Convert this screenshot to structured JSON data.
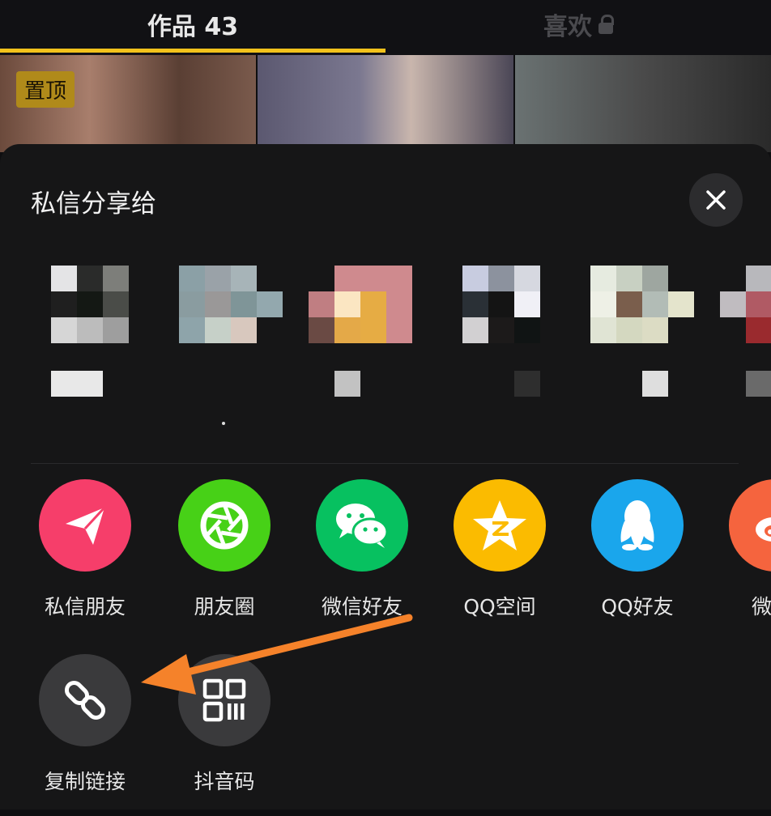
{
  "tabs": {
    "works": "作品 43",
    "likes": "喜欢"
  },
  "grid": {
    "pinned_badge": "置顶"
  },
  "share_sheet": {
    "title": "私信分享给",
    "apps": [
      {
        "label": "私信朋友",
        "icon": "paper-plane-icon",
        "color": "#f63e6a"
      },
      {
        "label": "朋友圈",
        "icon": "aperture-icon",
        "color": "#47d117"
      },
      {
        "label": "微信好友",
        "icon": "wechat-icon",
        "color": "#07c160"
      },
      {
        "label": "QQ空间",
        "icon": "qzone-star-icon",
        "color": "#fbbb00"
      },
      {
        "label": "QQ好友",
        "icon": "qq-penguin-icon",
        "color": "#1aa6ec"
      },
      {
        "label": "微",
        "icon": "weibo-icon",
        "color": "#f5643e"
      }
    ],
    "extras": [
      {
        "label": "复制链接",
        "icon": "link-icon"
      },
      {
        "label": "抖音码",
        "icon": "qr-code-icon"
      }
    ]
  },
  "colors": {
    "accent": "#f2c21c",
    "annotation_arrow": "#f5822a"
  }
}
